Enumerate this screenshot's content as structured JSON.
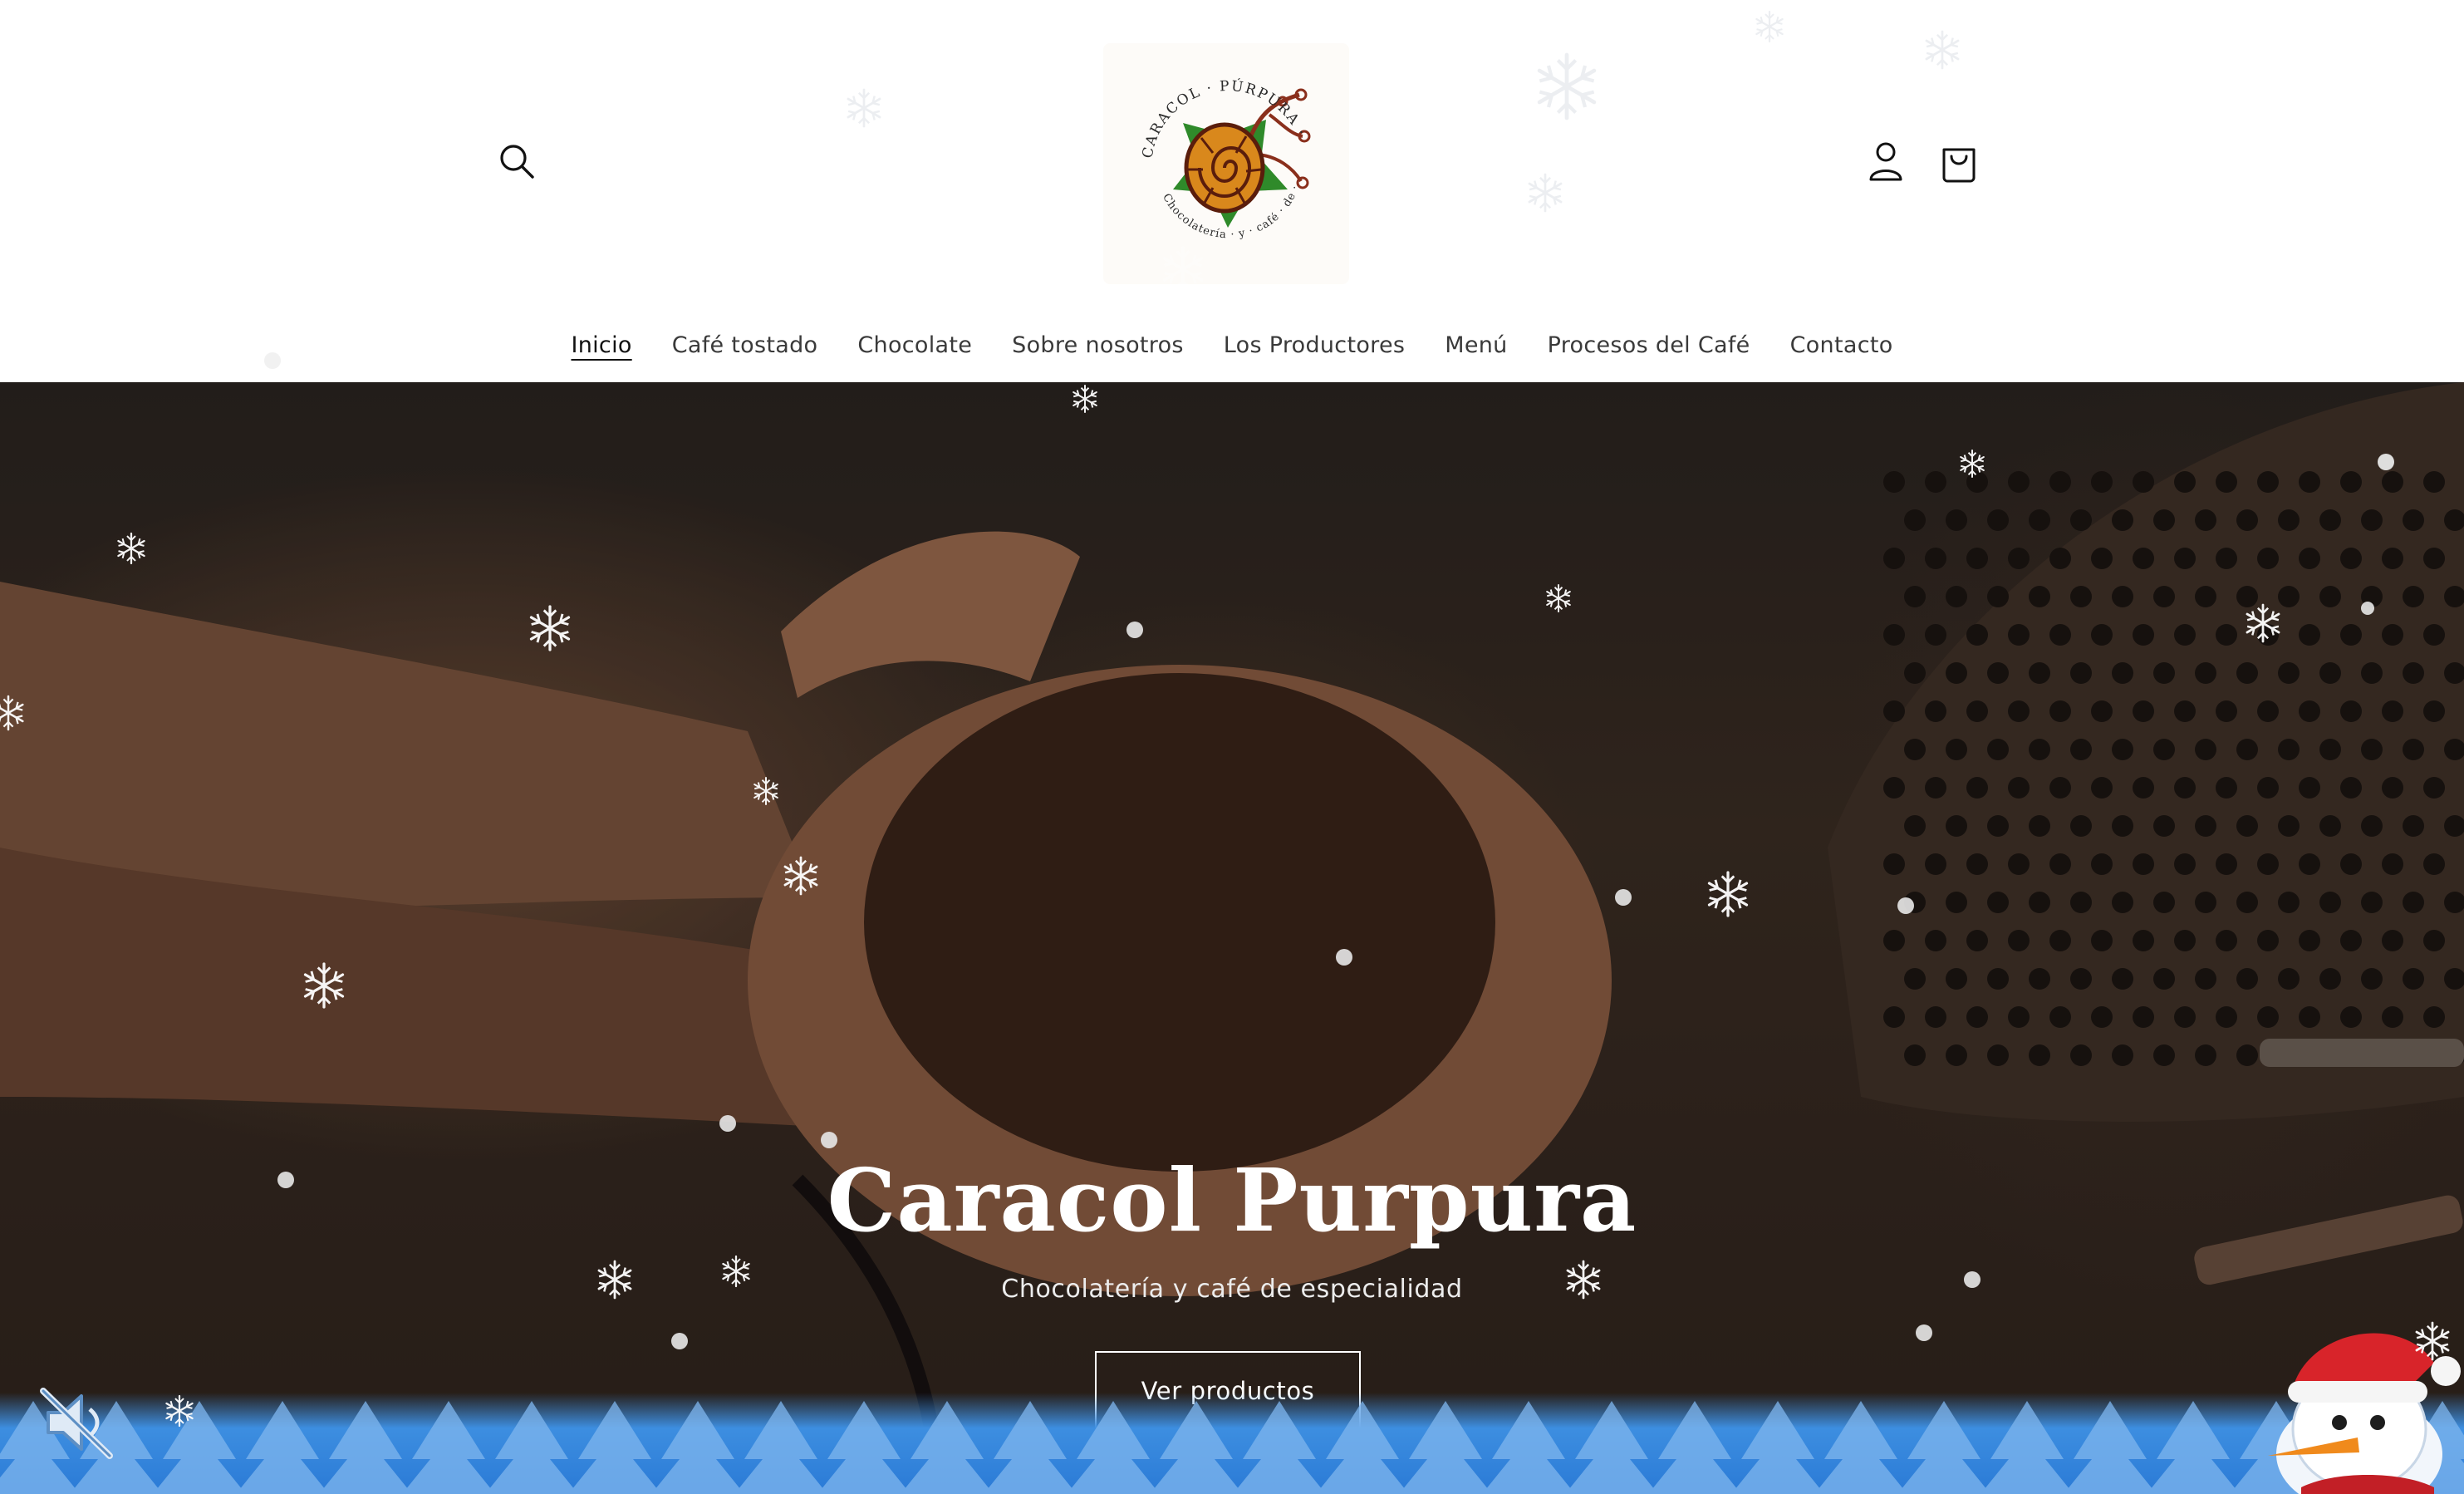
{
  "header": {
    "search_icon": "search-icon",
    "account_icon": "user-icon",
    "cart_icon": "shopping-bag-icon",
    "logo": {
      "ring_text_top": "CARACOL · PÚRPURA ·",
      "ring_text_bottom": "Chocolatería · y · café · de · especialidad",
      "colors": {
        "shell": "#d9881c",
        "shell_dark": "#5a1d0c",
        "leaf": "#2f8a2a",
        "branch": "#8a2f1c"
      }
    }
  },
  "nav": {
    "items": [
      {
        "label": "Inicio",
        "active": true
      },
      {
        "label": "Café tostado",
        "active": false
      },
      {
        "label": "Chocolate",
        "active": false
      },
      {
        "label": "Sobre nosotros",
        "active": false
      },
      {
        "label": "Los Productores",
        "active": false
      },
      {
        "label": "Menú",
        "active": false
      },
      {
        "label": "Procesos del Café",
        "active": false
      },
      {
        "label": "Contacto",
        "active": false
      }
    ]
  },
  "hero": {
    "title": "Caracol Purpura",
    "subtitle": "Chocolatería y café de especialidad",
    "cta_label": "Ver productos",
    "image_subject": "hands holding roasted cacao beans"
  },
  "winter_overlay": {
    "mute_icon": "speaker-muted-icon",
    "mascot_icon": "snowman-icon",
    "snowflake_icon": "snowflake-icon",
    "band_color": "#2a7ad6"
  }
}
